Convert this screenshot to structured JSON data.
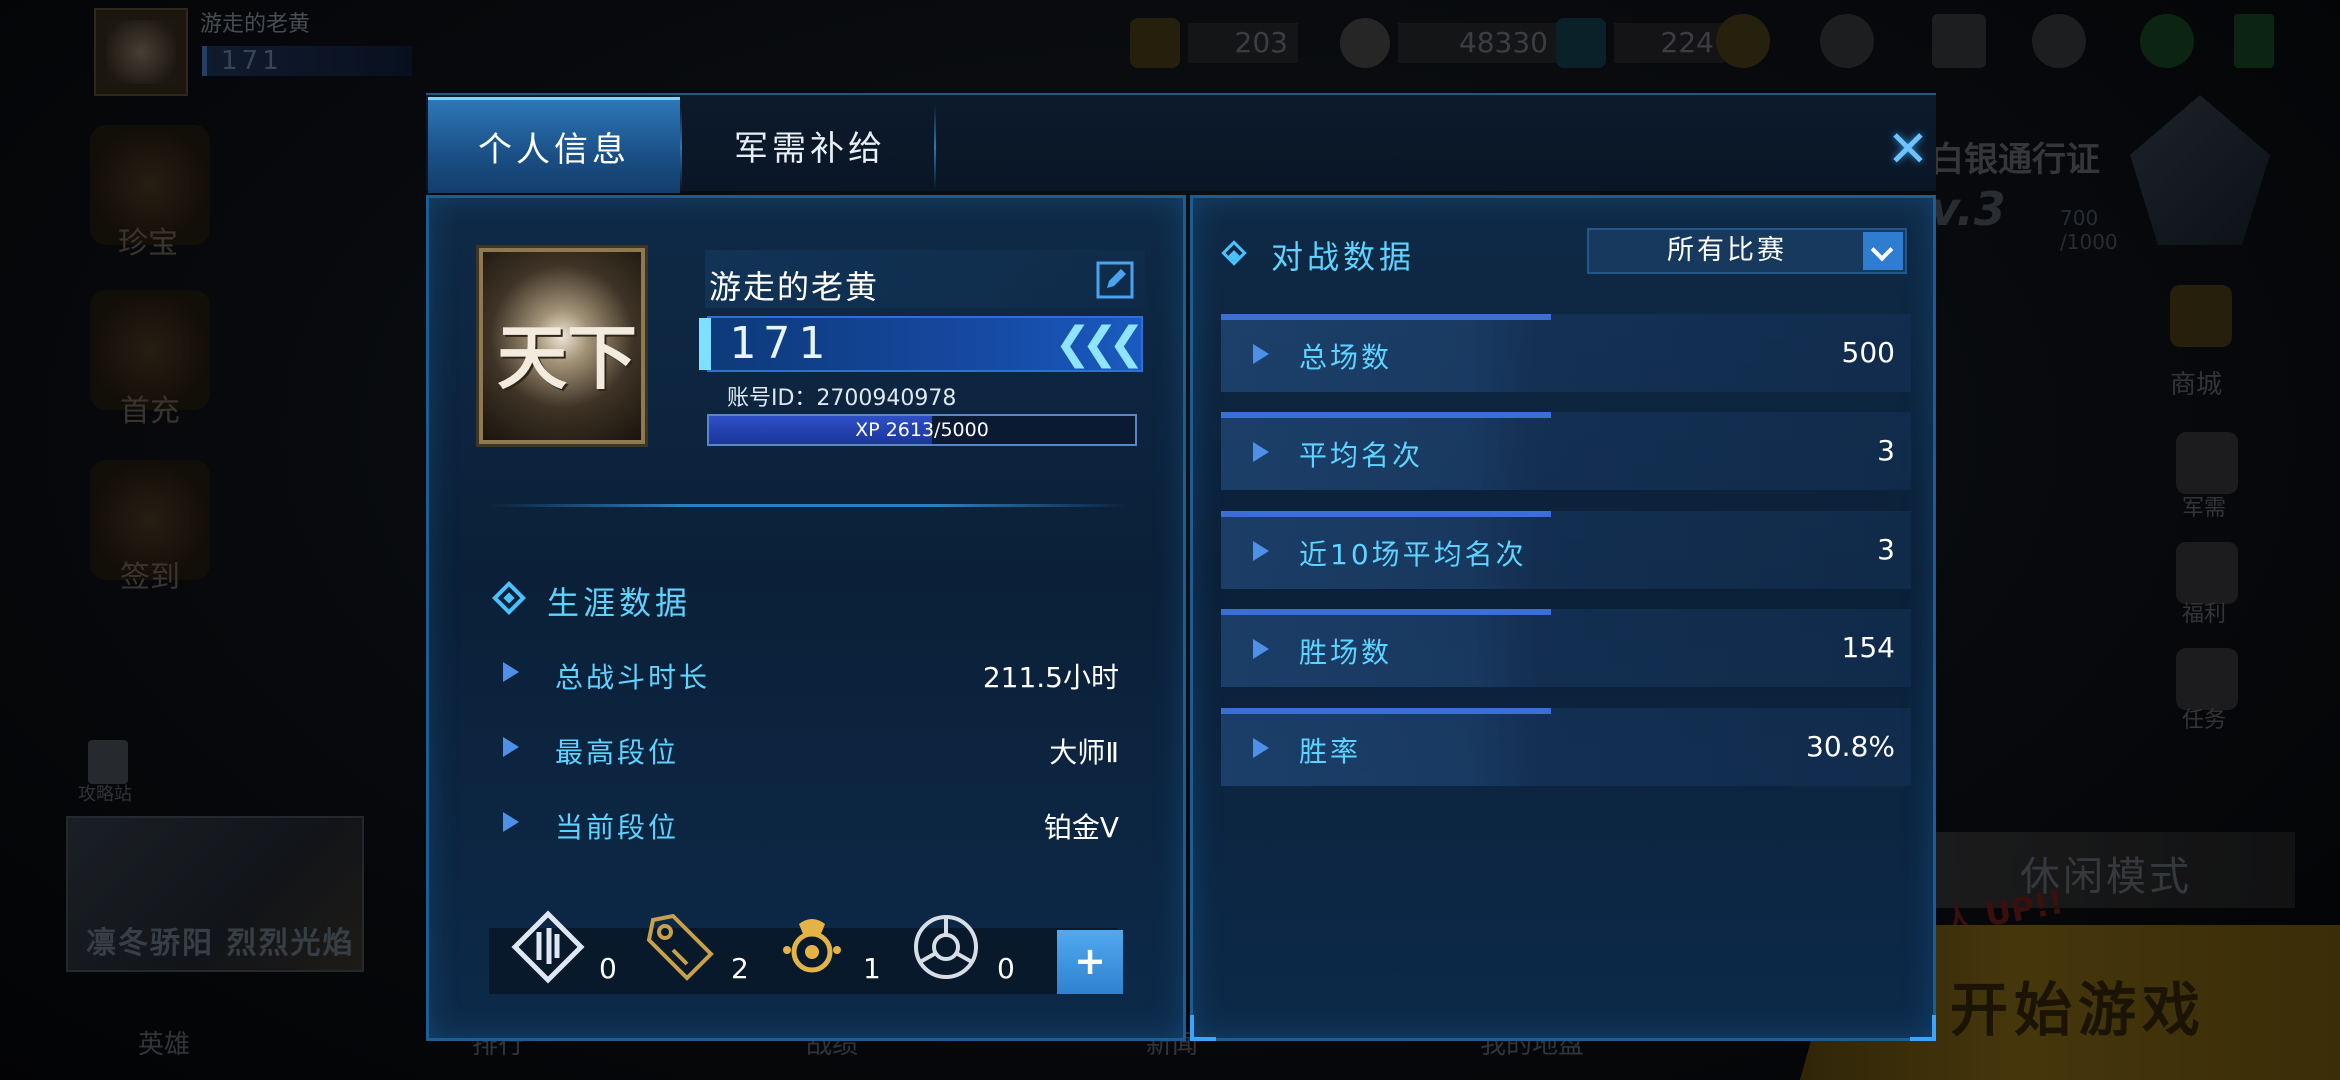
{
  "background": {
    "player_name": "游走的老黄",
    "player_level": "171",
    "resources": [
      {
        "icon": "card-icon",
        "value": "203"
      },
      {
        "icon": "coin-icon",
        "value": "48330"
      },
      {
        "icon": "gem-icon",
        "value": "224"
      }
    ],
    "left_menu": [
      "珍宝",
      "首充",
      "签到"
    ],
    "strategy_label": "攻略站",
    "banner_text": "凛冬骄阳 烈烈光焰",
    "pass_title": "白银通行证",
    "pass_level": "v.3",
    "pass_progress": "700 /1000",
    "right_menu": [
      "商城",
      "军需",
      "福利",
      "任务"
    ],
    "leisure_mode": "休闲模式",
    "promo_text": "乱人 UP!!",
    "start_game": "开始游戏",
    "bottom_nav": [
      "英雄",
      "排行",
      "战绩",
      "新闻",
      "我的地盘"
    ]
  },
  "modal": {
    "tabs": [
      {
        "label": "个人信息",
        "active": true
      },
      {
        "label": "军需补给",
        "active": false
      }
    ],
    "profile": {
      "name": "游走的老黄",
      "level": "171",
      "account_id": "账号ID：2700940978",
      "xp_text": "XP 2613/5000",
      "xp_current": 2613,
      "xp_max": 5000,
      "avatar_glyph": "天下"
    },
    "career": {
      "title": "生涯数据",
      "rows": [
        {
          "label": "总战斗时长",
          "value": "211.5小时"
        },
        {
          "label": "最高段位",
          "value": "大师Ⅱ"
        },
        {
          "label": "当前段位",
          "value": "铂金Ⅴ"
        }
      ]
    },
    "items": [
      {
        "icon": "badge-icon",
        "count": "0"
      },
      {
        "icon": "tag-icon",
        "count": "2"
      },
      {
        "icon": "helmet-icon",
        "count": "1"
      },
      {
        "icon": "compass-icon",
        "count": "0"
      }
    ],
    "add_label": "+",
    "battle": {
      "title": "对战数据",
      "filter": "所有比赛",
      "rows": [
        {
          "label": "总场数",
          "value": "500"
        },
        {
          "label": "平均名次",
          "value": "3"
        },
        {
          "label": "近10场平均名次",
          "value": "3"
        },
        {
          "label": "胜场数",
          "value": "154"
        },
        {
          "label": "胜率",
          "value": "30.8%"
        }
      ]
    },
    "colors": {
      "accent": "#5fd3ff",
      "panel": "#0b2038",
      "tab_active": "#2d77b8",
      "stat_bar": "#3b6fd6"
    }
  }
}
